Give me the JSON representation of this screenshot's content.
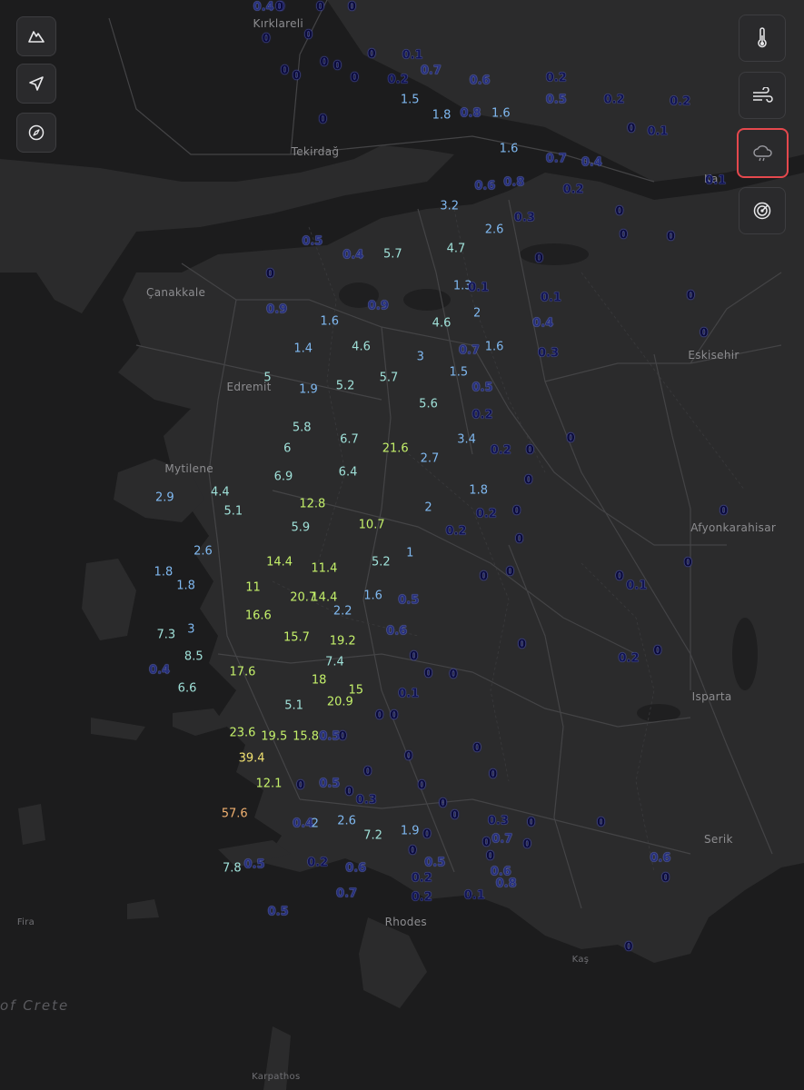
{
  "controls": {
    "left": [
      {
        "name": "terrain-button",
        "icon": "mountain-icon"
      },
      {
        "name": "locate-button",
        "icon": "navigation-arrow-icon"
      },
      {
        "name": "compass-button",
        "icon": "compass-icon"
      }
    ],
    "right": [
      {
        "name": "temperature-layer-button",
        "icon": "thermometer-icon",
        "active": false
      },
      {
        "name": "wind-layer-button",
        "icon": "wind-icon",
        "active": false
      },
      {
        "name": "precipitation-layer-button",
        "icon": "rain-cloud-icon",
        "active": true
      },
      {
        "name": "radar-layer-button",
        "icon": "radar-icon",
        "active": false
      }
    ]
  },
  "places": [
    {
      "name": "Kırklareli",
      "lat": 41.74,
      "lon": 27.22
    },
    {
      "name": "Tekirdağ",
      "lat": 40.98,
      "lon": 27.51
    },
    {
      "name": "Çanakkale",
      "lat": 40.15,
      "lon": 26.41
    },
    {
      "name": "Edremit",
      "lat": 39.59,
      "lon": 27.02
    },
    {
      "name": "Mytilene",
      "lat": 39.11,
      "lon": 26.55
    },
    {
      "name": "Eskisehir",
      "lat": 39.78,
      "lon": 30.52
    },
    {
      "name": "Afyonkarahisar",
      "lat": 38.76,
      "lon": 30.54
    },
    {
      "name": "Isparta",
      "lat": 37.76,
      "lon": 30.55
    },
    {
      "name": "Serik",
      "lat": 36.92,
      "lon": 31.1
    },
    {
      "name": "Rhodes",
      "lat": 36.43,
      "lon": 28.22
    },
    {
      "name": "Fira",
      "lat": 36.42,
      "lon": 25.43
    },
    {
      "name": "Kaş",
      "lat": 36.2,
      "lon": 29.64
    },
    {
      "name": "Karpathos",
      "lat": 35.51,
      "lon": 27.21
    },
    {
      "name": "of Crete",
      "lat": 35.95,
      "lon": 24.9
    },
    {
      "name": "Ka",
      "lat": 40.82,
      "lon": 31.15
    }
  ],
  "precipitation": [
    {
      "v": "0",
      "lat": 41.96,
      "lon": 27.43
    },
    {
      "v": "0",
      "lat": 41.93,
      "lon": 27.73
    },
    {
      "v": "0.4",
      "lat": 41.84,
      "lon": 27.3
    },
    {
      "v": "0",
      "lat": 41.8,
      "lon": 27.42
    },
    {
      "v": "0",
      "lat": 41.85,
      "lon": 27.97
    },
    {
      "v": "0",
      "lat": 41.61,
      "lon": 27.32
    },
    {
      "v": "0",
      "lat": 41.63,
      "lon": 27.64
    },
    {
      "v": "0",
      "lat": 41.52,
      "lon": 28.12
    },
    {
      "v": "0.1",
      "lat": 41.51,
      "lon": 28.43
    },
    {
      "v": "0",
      "lat": 41.47,
      "lon": 27.76
    },
    {
      "v": "0",
      "lat": 41.45,
      "lon": 27.86
    },
    {
      "v": "0",
      "lat": 41.42,
      "lon": 27.46
    },
    {
      "v": "0",
      "lat": 41.39,
      "lon": 27.55
    },
    {
      "v": "0",
      "lat": 41.38,
      "lon": 27.99
    },
    {
      "v": "0.2",
      "lat": 41.37,
      "lon": 28.32
    },
    {
      "v": "0.7",
      "lat": 41.42,
      "lon": 28.57
    },
    {
      "v": "0.6",
      "lat": 41.36,
      "lon": 28.94
    },
    {
      "v": "0.2",
      "lat": 41.38,
      "lon": 29.52
    },
    {
      "v": "1.5",
      "lat": 41.25,
      "lon": 28.41
    },
    {
      "v": "1.8",
      "lat": 41.16,
      "lon": 28.65
    },
    {
      "v": "0.8",
      "lat": 41.17,
      "lon": 28.87
    },
    {
      "v": "1.6",
      "lat": 41.17,
      "lon": 29.1
    },
    {
      "v": "0.5",
      "lat": 41.25,
      "lon": 29.52
    },
    {
      "v": "0.2",
      "lat": 41.25,
      "lon": 29.96
    },
    {
      "v": "0.2",
      "lat": 41.24,
      "lon": 30.46
    },
    {
      "v": "0",
      "lat": 41.13,
      "lon": 27.75
    },
    {
      "v": "1.6",
      "lat": 40.96,
      "lon": 29.16
    },
    {
      "v": "0.7",
      "lat": 40.9,
      "lon": 29.52
    },
    {
      "v": "0.4",
      "lat": 40.88,
      "lon": 29.79
    },
    {
      "v": "0.1",
      "lat": 41.06,
      "lon": 30.29
    },
    {
      "v": "0",
      "lat": 41.08,
      "lon": 30.09
    },
    {
      "v": "0.6",
      "lat": 40.74,
      "lon": 28.98
    },
    {
      "v": "0.8",
      "lat": 40.76,
      "lon": 29.2
    },
    {
      "v": "0.2",
      "lat": 40.72,
      "lon": 29.65
    },
    {
      "v": "0.1",
      "lat": 40.77,
      "lon": 30.73
    },
    {
      "v": "3.2",
      "lat": 40.62,
      "lon": 28.71
    },
    {
      "v": "0",
      "lat": 40.59,
      "lon": 30.0
    },
    {
      "v": "0.3",
      "lat": 40.55,
      "lon": 29.28
    },
    {
      "v": "2.6",
      "lat": 40.48,
      "lon": 29.05
    },
    {
      "v": "0",
      "lat": 40.45,
      "lon": 30.03
    },
    {
      "v": "0",
      "lat": 40.44,
      "lon": 30.39
    },
    {
      "v": "0.5",
      "lat": 40.41,
      "lon": 27.67
    },
    {
      "v": "0.4",
      "lat": 40.33,
      "lon": 27.98
    },
    {
      "v": "5.7",
      "lat": 40.34,
      "lon": 28.28
    },
    {
      "v": "4.7",
      "lat": 40.37,
      "lon": 28.76
    },
    {
      "v": "0",
      "lat": 40.31,
      "lon": 29.39
    },
    {
      "v": "0",
      "lat": 40.22,
      "lon": 27.35
    },
    {
      "v": "1.3",
      "lat": 40.15,
      "lon": 28.81
    },
    {
      "v": "0.1",
      "lat": 40.14,
      "lon": 28.93
    },
    {
      "v": "0.1",
      "lat": 40.08,
      "lon": 29.48
    },
    {
      "v": "0",
      "lat": 40.09,
      "lon": 30.54
    },
    {
      "v": "0.9",
      "lat": 40.01,
      "lon": 27.4
    },
    {
      "v": "0.9",
      "lat": 40.03,
      "lon": 28.17
    },
    {
      "v": "2",
      "lat": 39.99,
      "lon": 28.92
    },
    {
      "v": "1.6",
      "lat": 39.94,
      "lon": 27.8
    },
    {
      "v": "4.6",
      "lat": 39.93,
      "lon": 28.65
    },
    {
      "v": "0.4",
      "lat": 39.93,
      "lon": 29.42
    },
    {
      "v": "0",
      "lat": 39.87,
      "lon": 30.64
    },
    {
      "v": "1.4",
      "lat": 39.78,
      "lon": 27.6
    },
    {
      "v": "4.6",
      "lat": 39.79,
      "lon": 28.04
    },
    {
      "v": "0.7",
      "lat": 39.77,
      "lon": 28.86
    },
    {
      "v": "1.6",
      "lat": 39.79,
      "lon": 29.05
    },
    {
      "v": "0.3",
      "lat": 39.75,
      "lon": 29.46
    },
    {
      "v": "3",
      "lat": 39.73,
      "lon": 28.49
    },
    {
      "v": "5",
      "lat": 39.61,
      "lon": 27.33
    },
    {
      "v": "5.7",
      "lat": 39.61,
      "lon": 28.25
    },
    {
      "v": "1.5",
      "lat": 39.64,
      "lon": 28.78
    },
    {
      "v": "1.9",
      "lat": 39.54,
      "lon": 27.64
    },
    {
      "v": "5.2",
      "lat": 39.56,
      "lon": 27.92
    },
    {
      "v": "0.5",
      "lat": 39.55,
      "lon": 28.96
    },
    {
      "v": "5.6",
      "lat": 39.45,
      "lon": 28.55
    },
    {
      "v": "0.2",
      "lat": 39.39,
      "lon": 28.96
    },
    {
      "v": "5.8",
      "lat": 39.31,
      "lon": 27.59
    },
    {
      "v": "6.7",
      "lat": 39.24,
      "lon": 27.95
    },
    {
      "v": "21.6",
      "lat": 39.19,
      "lon": 28.3
    },
    {
      "v": "3.4",
      "lat": 39.24,
      "lon": 28.84
    },
    {
      "v": "0",
      "lat": 39.25,
      "lon": 29.63
    },
    {
      "v": "0.2",
      "lat": 39.18,
      "lon": 29.1
    },
    {
      "v": "0",
      "lat": 39.18,
      "lon": 29.32
    },
    {
      "v": "6",
      "lat": 39.19,
      "lon": 27.48
    },
    {
      "v": "2.7",
      "lat": 39.13,
      "lon": 28.56
    },
    {
      "v": "6.4",
      "lat": 39.05,
      "lon": 27.94
    },
    {
      "v": "6.9",
      "lat": 39.02,
      "lon": 27.45
    },
    {
      "v": "0",
      "lat": 39.0,
      "lon": 29.31
    },
    {
      "v": "1.8",
      "lat": 38.94,
      "lon": 28.93
    },
    {
      "v": "4.4",
      "lat": 38.93,
      "lon": 26.97
    },
    {
      "v": "2.9",
      "lat": 38.9,
      "lon": 26.55
    },
    {
      "v": "12.8",
      "lat": 38.86,
      "lon": 27.67
    },
    {
      "v": "2",
      "lat": 38.84,
      "lon": 28.55
    },
    {
      "v": "0.2",
      "lat": 38.8,
      "lon": 28.99
    },
    {
      "v": "0",
      "lat": 38.82,
      "lon": 29.22
    },
    {
      "v": "0",
      "lat": 38.82,
      "lon": 30.79
    },
    {
      "v": "5.1",
      "lat": 38.82,
      "lon": 27.07
    },
    {
      "v": "10.7",
      "lat": 38.74,
      "lon": 28.12
    },
    {
      "v": "5.9",
      "lat": 38.72,
      "lon": 27.58
    },
    {
      "v": "0.2",
      "lat": 38.7,
      "lon": 28.76
    },
    {
      "v": "0",
      "lat": 38.65,
      "lon": 29.24
    },
    {
      "v": "2.6",
      "lat": 38.58,
      "lon": 26.84
    },
    {
      "v": "1",
      "lat": 38.57,
      "lon": 28.41
    },
    {
      "v": "14.4",
      "lat": 38.52,
      "lon": 27.42
    },
    {
      "v": "5.2",
      "lat": 38.52,
      "lon": 28.19
    },
    {
      "v": "11.4",
      "lat": 38.48,
      "lon": 27.76
    },
    {
      "v": "0",
      "lat": 38.51,
      "lon": 30.52
    },
    {
      "v": "1.8",
      "lat": 38.46,
      "lon": 26.54
    },
    {
      "v": "0",
      "lat": 38.46,
      "lon": 29.17
    },
    {
      "v": "0",
      "lat": 38.43,
      "lon": 28.97
    },
    {
      "v": "0",
      "lat": 38.43,
      "lon": 30.0
    },
    {
      "v": "1.8",
      "lat": 38.38,
      "lon": 26.71
    },
    {
      "v": "11",
      "lat": 38.37,
      "lon": 27.22
    },
    {
      "v": "0.1",
      "lat": 38.38,
      "lon": 30.13
    },
    {
      "v": "20.7",
      "lat": 38.31,
      "lon": 27.6
    },
    {
      "v": "14.4",
      "lat": 38.31,
      "lon": 27.76
    },
    {
      "v": "1.6",
      "lat": 38.32,
      "lon": 28.13
    },
    {
      "v": "0.5",
      "lat": 38.29,
      "lon": 28.4
    },
    {
      "v": "2.2",
      "lat": 38.23,
      "lon": 27.9
    },
    {
      "v": "16.6",
      "lat": 38.2,
      "lon": 27.26
    },
    {
      "v": "3",
      "lat": 38.12,
      "lon": 26.75
    },
    {
      "v": "7.3",
      "lat": 38.09,
      "lon": 26.56
    },
    {
      "v": "0.6",
      "lat": 38.11,
      "lon": 28.31
    },
    {
      "v": "15.7",
      "lat": 38.07,
      "lon": 27.55
    },
    {
      "v": "19.2",
      "lat": 38.05,
      "lon": 27.9
    },
    {
      "v": "0",
      "lat": 38.03,
      "lon": 29.26
    },
    {
      "v": "8.5",
      "lat": 37.96,
      "lon": 26.77
    },
    {
      "v": "0",
      "lat": 37.96,
      "lon": 28.44
    },
    {
      "v": "0.2",
      "lat": 37.95,
      "lon": 30.07
    },
    {
      "v": "0",
      "lat": 37.99,
      "lon": 30.29
    },
    {
      "v": "7.4",
      "lat": 37.93,
      "lon": 27.84
    },
    {
      "v": "0.4",
      "lat": 37.88,
      "lon": 26.51
    },
    {
      "v": "17.6",
      "lat": 37.87,
      "lon": 27.14
    },
    {
      "v": "0",
      "lat": 37.86,
      "lon": 28.55
    },
    {
      "v": "0",
      "lat": 37.85,
      "lon": 28.74
    },
    {
      "v": "18",
      "lat": 37.82,
      "lon": 27.72
    },
    {
      "v": "15",
      "lat": 37.76,
      "lon": 28.0
    },
    {
      "v": "6.6",
      "lat": 37.77,
      "lon": 26.72
    },
    {
      "v": "0.1",
      "lat": 37.74,
      "lon": 28.4
    },
    {
      "v": "20.9",
      "lat": 37.69,
      "lon": 27.88
    },
    {
      "v": "5.1",
      "lat": 37.67,
      "lon": 27.53
    },
    {
      "v": "0",
      "lat": 37.61,
      "lon": 28.18
    },
    {
      "v": "0",
      "lat": 37.61,
      "lon": 28.29
    },
    {
      "v": "23.6",
      "lat": 37.51,
      "lon": 27.14
    },
    {
      "v": "19.5",
      "lat": 37.49,
      "lon": 27.38
    },
    {
      "v": "15.8",
      "lat": 37.49,
      "lon": 27.62
    },
    {
      "v": "0.5",
      "lat": 37.49,
      "lon": 27.8
    },
    {
      "v": "0",
      "lat": 37.49,
      "lon": 27.9
    },
    {
      "v": "0",
      "lat": 37.42,
      "lon": 28.92
    },
    {
      "v": "39.4",
      "lat": 37.36,
      "lon": 27.21
    },
    {
      "v": "0",
      "lat": 37.37,
      "lon": 28.4
    },
    {
      "v": "0",
      "lat": 37.28,
      "lon": 28.09
    },
    {
      "v": "0",
      "lat": 37.26,
      "lon": 29.04
    },
    {
      "v": "12.1",
      "lat": 37.21,
      "lon": 27.34
    },
    {
      "v": "0",
      "lat": 37.2,
      "lon": 27.58
    },
    {
      "v": "0.5",
      "lat": 37.21,
      "lon": 27.8
    },
    {
      "v": "0",
      "lat": 37.2,
      "lon": 28.5
    },
    {
      "v": "0",
      "lat": 37.16,
      "lon": 27.95
    },
    {
      "v": "0.3",
      "lat": 37.11,
      "lon": 28.08
    },
    {
      "v": "0",
      "lat": 37.09,
      "lon": 28.66
    },
    {
      "v": "57.6",
      "lat": 37.03,
      "lon": 27.08
    },
    {
      "v": "0",
      "lat": 37.02,
      "lon": 28.75
    },
    {
      "v": "2.6",
      "lat": 36.99,
      "lon": 27.93
    },
    {
      "v": "0.4",
      "lat": 36.97,
      "lon": 27.6
    },
    {
      "v": "2",
      "lat": 36.97,
      "lon": 27.69
    },
    {
      "v": "0.3",
      "lat": 36.99,
      "lon": 29.08
    },
    {
      "v": "0",
      "lat": 36.98,
      "lon": 29.33
    },
    {
      "v": "0",
      "lat": 36.98,
      "lon": 29.86
    },
    {
      "v": "1.9",
      "lat": 36.93,
      "lon": 28.41
    },
    {
      "v": "0",
      "lat": 36.91,
      "lon": 28.54
    },
    {
      "v": "7.2",
      "lat": 36.9,
      "lon": 28.13
    },
    {
      "v": "0.7",
      "lat": 36.88,
      "lon": 29.11
    },
    {
      "v": "0",
      "lat": 36.86,
      "lon": 28.99
    },
    {
      "v": "0",
      "lat": 36.85,
      "lon": 29.3
    },
    {
      "v": "0",
      "lat": 36.81,
      "lon": 28.43
    },
    {
      "v": "0",
      "lat": 36.78,
      "lon": 29.02
    },
    {
      "v": "0.5",
      "lat": 36.74,
      "lon": 28.6
    },
    {
      "v": "0.6",
      "lat": 36.77,
      "lon": 30.31
    },
    {
      "v": "0.5",
      "lat": 36.73,
      "lon": 27.23
    },
    {
      "v": "7.8",
      "lat": 36.71,
      "lon": 27.06
    },
    {
      "v": "0.2",
      "lat": 36.74,
      "lon": 27.71
    },
    {
      "v": "0.6",
      "lat": 36.71,
      "lon": 28.0
    },
    {
      "v": "0.6",
      "lat": 36.69,
      "lon": 29.1
    },
    {
      "v": "0.2",
      "lat": 36.65,
      "lon": 28.5
    },
    {
      "v": "0",
      "lat": 36.65,
      "lon": 30.35
    },
    {
      "v": "0.8",
      "lat": 36.62,
      "lon": 29.14
    },
    {
      "v": "0.7",
      "lat": 36.56,
      "lon": 27.93
    },
    {
      "v": "0.2",
      "lat": 36.54,
      "lon": 28.5
    },
    {
      "v": "0.1",
      "lat": 36.55,
      "lon": 28.9
    },
    {
      "v": "0.5",
      "lat": 36.45,
      "lon": 27.41
    },
    {
      "v": "0",
      "lat": 36.24,
      "lon": 30.07
    }
  ],
  "map_bounds": {
    "north": 41.84,
    "south": 35.4,
    "west": 25.3,
    "east": 31.4
  }
}
